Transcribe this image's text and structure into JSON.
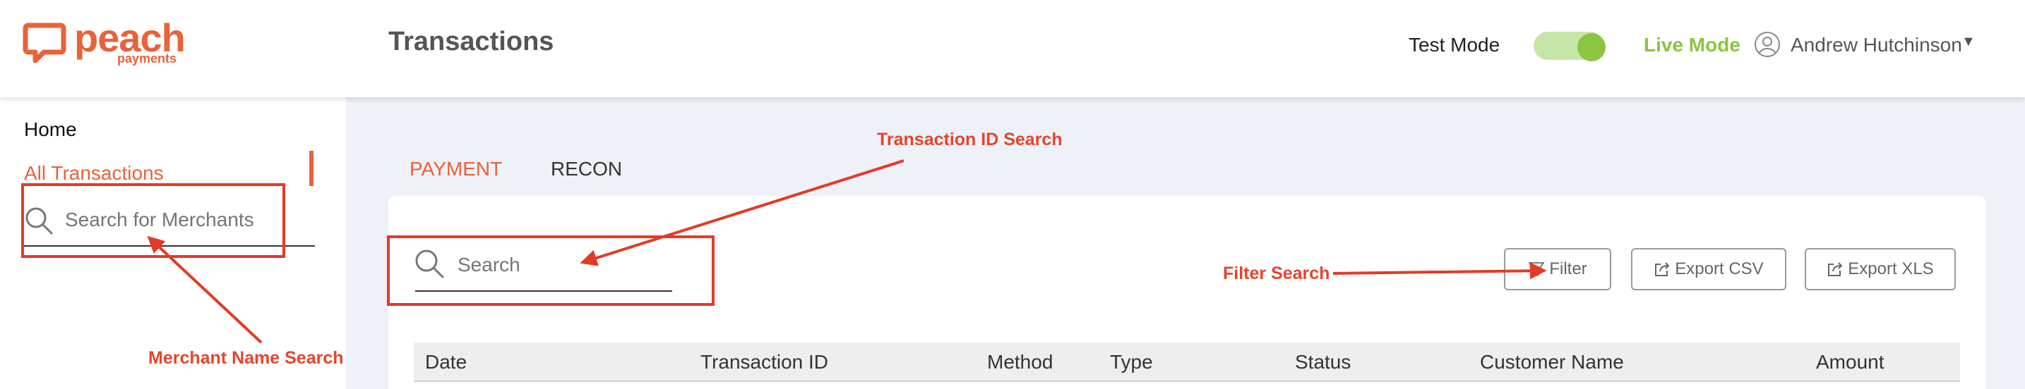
{
  "header": {
    "logo": {
      "word": "peach",
      "sub": "payments"
    },
    "page_title": "Transactions",
    "test_mode_label": "Test Mode",
    "live_mode_label": "Live Mode",
    "user_name": "Andrew Hutchinson",
    "mode_toggle_on": true
  },
  "sidebar": {
    "items": [
      {
        "label": "Home"
      },
      {
        "label": "All Transactions",
        "active": true
      }
    ],
    "merchant_search": {
      "placeholder": "Search for Merchants",
      "value": ""
    }
  },
  "main": {
    "tabs": [
      {
        "label": "PAYMENT",
        "active": true
      },
      {
        "label": "RECON",
        "active": false
      }
    ],
    "search": {
      "placeholder": "Search",
      "value": ""
    },
    "buttons": {
      "filter": "Filter",
      "export_csv": "Export CSV",
      "export_xls": "Export XLS"
    },
    "table": {
      "columns": [
        "Date",
        "Transaction ID",
        "Method",
        "Type",
        "Status",
        "Customer Name",
        "Amount"
      ]
    }
  },
  "annotations": {
    "transaction_id_search": "Transaction ID Search",
    "filter_search": "Filter Search",
    "merchant_name_search": "Merchant Name Search"
  },
  "colors": {
    "brand": "#e8623a",
    "live": "#8ac63f",
    "annotation": "#e23b26",
    "main_bg": "#eef1f7"
  },
  "icons": [
    "peach-logo-icon",
    "user-circle-icon",
    "caret-down-icon",
    "search-icon",
    "filter-icon",
    "export-icon"
  ]
}
